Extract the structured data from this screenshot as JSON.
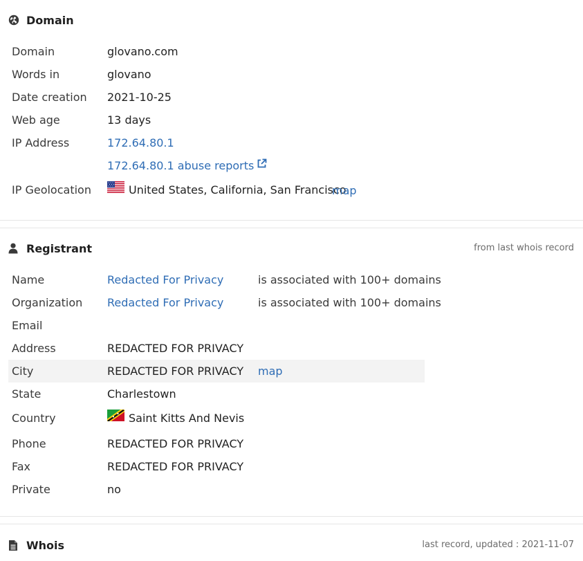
{
  "domain_section": {
    "title": "Domain",
    "rows": [
      {
        "label": "Domain",
        "value": "glovano.com"
      },
      {
        "label": "Words in",
        "value": "glovano"
      },
      {
        "label": "Date creation",
        "value": "2021-10-25"
      },
      {
        "label": "Web age",
        "value": "13 days"
      },
      {
        "label": "IP Address",
        "value": "172.64.80.1"
      },
      {
        "label": "",
        "value": "172.64.80.1 abuse reports"
      },
      {
        "label": "IP Geolocation",
        "value": "United States, California, San Francisco",
        "extra": "map"
      }
    ]
  },
  "registrant_section": {
    "title": "Registrant",
    "note": "from last whois record",
    "rows": [
      {
        "label": "Name",
        "value": "Redacted For Privacy",
        "extra": "is associated with 100+ domains"
      },
      {
        "label": "Organization",
        "value": "Redacted For Privacy",
        "extra": "is associated with 100+ domains"
      },
      {
        "label": "Email",
        "value": ""
      },
      {
        "label": "Address",
        "value": "REDACTED FOR PRIVACY"
      },
      {
        "label": "City",
        "value": "REDACTED FOR PRIVACY",
        "extra": "map"
      },
      {
        "label": "State",
        "value": "Charlestown"
      },
      {
        "label": "Country",
        "value": "Saint Kitts And Nevis"
      },
      {
        "label": "Phone",
        "value": "REDACTED FOR PRIVACY"
      },
      {
        "label": "Fax",
        "value": "REDACTED FOR PRIVACY"
      },
      {
        "label": "Private",
        "value": "no"
      }
    ]
  },
  "whois_section": {
    "title": "Whois",
    "note": "last record, updated : 2021-11-07"
  },
  "icons": {
    "domain": "globe-icon",
    "registrant": "user-icon",
    "whois": "document-icon",
    "abuse_link": "external-link-icon",
    "us_flag": "us-flag-icon",
    "kn_flag": "kn-flag-icon"
  },
  "colors": {
    "link": "#2f6db5",
    "highlight_row": "#f3f3f3",
    "divider": "#e6e6e6"
  }
}
